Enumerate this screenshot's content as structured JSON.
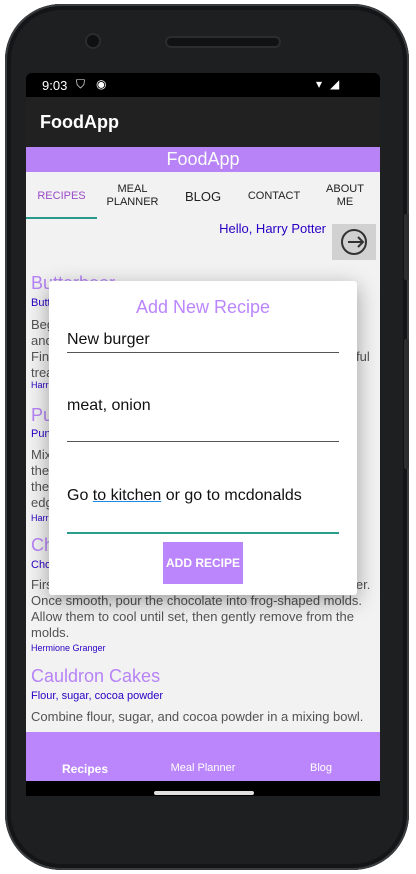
{
  "status_bar": {
    "time": "9:03"
  },
  "app_bar": {
    "title": "FoodApp"
  },
  "banner": {
    "title": "FoodApp"
  },
  "tabs": [
    {
      "label": "RECIPES",
      "active": true
    },
    {
      "label": "MEAL\nPLANNER",
      "active": false
    },
    {
      "label": "BLOG",
      "active": false
    },
    {
      "label": "CONTACT",
      "active": false
    },
    {
      "label": "ABOUT\nME",
      "active": false
    }
  ],
  "greeting": "Hello, Harry Potter",
  "recipes": [
    {
      "title": "Butterbeer",
      "ingredients": "Butter",
      "description": "Beg\nand\nFin\ntrea",
      "author": "Harr"
    },
    {
      "title": "Pu",
      "ingredients": "Pun",
      "description": "Mix\nthe\nthe\nedg",
      "author": "Harr"
    },
    {
      "title": "Ch",
      "ingredients": "Cho",
      "description": "Firs\nOnce smooth, pour the chocolate into frog-shaped molds. Allow them to cool until set, then gently remove from the molds.",
      "author": "Hermione Granger"
    },
    {
      "title": "Cauldron Cakes",
      "ingredients": "Flour, sugar, cocoa powder",
      "description": "Combine flour, sugar, and cocoa powder in a mixing bowl.",
      "author": ""
    }
  ],
  "recipe_edge_text": {
    "r1_line3_right": "ful",
    "r3_line1_right": "ler."
  },
  "dialog": {
    "title": "Add New Recipe",
    "name_value": "New burger",
    "ingredients_value": "meat, onion",
    "instructions_before": "Go ",
    "instructions_underlined": "to kitchen",
    "instructions_after": " or go to mcdonalds",
    "submit_label": "ADD RECIPE"
  },
  "fab": {
    "icon": "plus-icon",
    "glyph": "+"
  },
  "bottom_nav": [
    {
      "label": "Recipes",
      "active": true
    },
    {
      "label": "Meal Planner",
      "active": false
    },
    {
      "label": "Blog",
      "active": false
    }
  ],
  "colors": {
    "accent": "#bb86fc",
    "teal": "#00786c",
    "link_blue": "#2a00c8",
    "app_bar": "#212121"
  }
}
